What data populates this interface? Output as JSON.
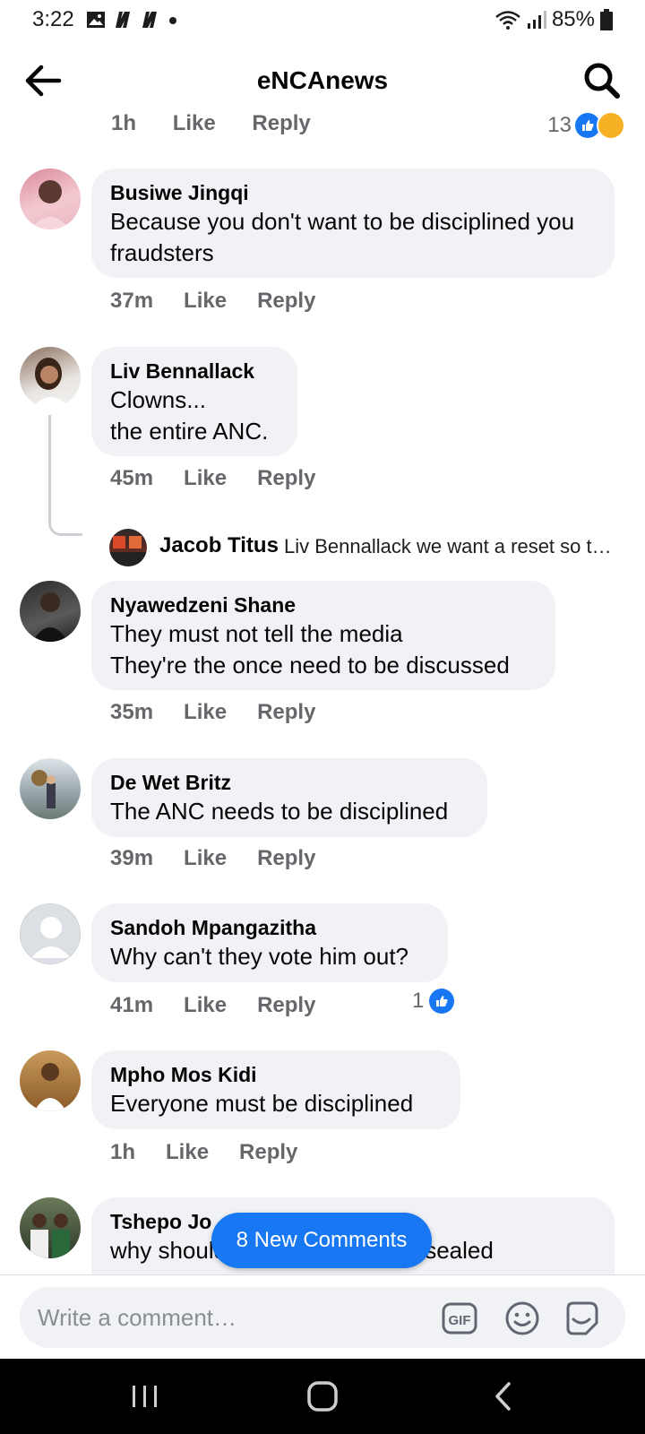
{
  "status_bar": {
    "time": "3:22",
    "battery": "85%",
    "icons": [
      "gallery-icon",
      "netflix-icon",
      "netflix-icon",
      "dot-icon",
      "wifi-icon",
      "signal-icon",
      "battery-icon"
    ]
  },
  "header": {
    "title": "eNCAnews",
    "back_icon": "arrow-left-icon",
    "search_icon": "search-icon"
  },
  "previous_comment": {
    "time": "1h",
    "like": "Like",
    "reply": "Reply",
    "reaction_count": "13"
  },
  "comments": [
    {
      "author": "Busiwe Jingqi",
      "lines": [
        "Because you don't want to be disciplined you",
        "fraudsters"
      ],
      "time": "37m",
      "like": "Like",
      "reply": "Reply"
    },
    {
      "author": "Liv Bennallack",
      "lines": [
        "Clowns...",
        "the entire ANC."
      ],
      "time": "45m",
      "like": "Like",
      "reply": "Reply"
    },
    {
      "author": "Nyawedzeni Shane",
      "lines": [
        "They must not tell the media",
        "They're the once need to be discussed"
      ],
      "time": "35m",
      "like": "Like",
      "reply": "Reply"
    },
    {
      "author": "De Wet Britz",
      "lines": [
        "The ANC needs to be disciplined"
      ],
      "time": "39m",
      "like": "Like",
      "reply": "Reply"
    },
    {
      "author": "Sandoh Mpangazitha",
      "lines": [
        "Why can't they vote him out?"
      ],
      "time": "41m",
      "like": "Like",
      "reply": "Reply",
      "like_count": "1"
    },
    {
      "author": "Mpho Mos Kidi",
      "lines": [
        "Everyone must be disciplined"
      ],
      "time": "1h",
      "like": "Like",
      "reply": "Reply"
    },
    {
      "author": "Tshepo Jo",
      "lines": [
        "why should the documents be sealed"
      ]
    }
  ],
  "reply_preview": {
    "author": "Jacob Titus",
    "text": "Liv Bennallack we want a reset so t…"
  },
  "new_comments_button": "8 New Comments",
  "composer": {
    "placeholder": "Write a comment…",
    "gif_label": "GIF"
  },
  "colors": {
    "accent": "#1877f2",
    "bubble": "#f0f2f5",
    "secondary_text": "#65676b"
  }
}
